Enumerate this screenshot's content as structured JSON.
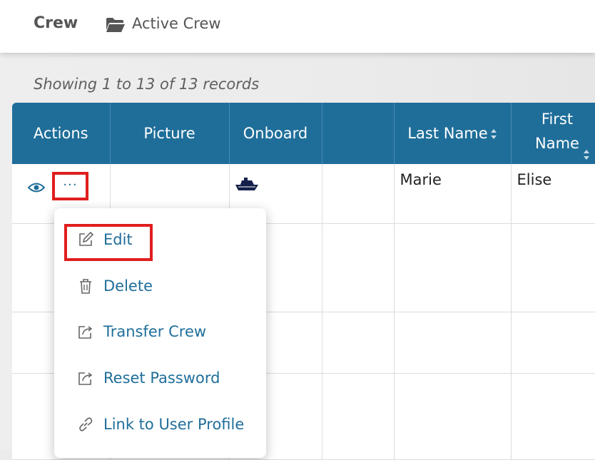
{
  "breadcrumb": {
    "root": "Crew",
    "active": "Active Crew",
    "active_icon": "folder-open-icon"
  },
  "records_info": "Showing 1 to 13 of 13 records",
  "table": {
    "columns": [
      {
        "label": "Actions",
        "sortable": false
      },
      {
        "label": "Picture",
        "sortable": false
      },
      {
        "label": "Onboard",
        "sortable": false
      },
      {
        "label": "",
        "sortable": false
      },
      {
        "label": "Last Name",
        "sortable": true
      },
      {
        "label": "First Name",
        "sortable": true
      }
    ],
    "rows": [
      {
        "last_name": "Marie",
        "first_name": "Elise",
        "onboard_icon": "ship-icon"
      }
    ]
  },
  "row_actions": {
    "view_icon": "eye-icon",
    "more_label": "···"
  },
  "context_menu": {
    "items": [
      {
        "label": "Edit",
        "icon": "edit-icon"
      },
      {
        "label": "Delete",
        "icon": "trash-icon"
      },
      {
        "label": "Transfer Crew",
        "icon": "export-icon"
      },
      {
        "label": "Reset Password",
        "icon": "export-icon"
      },
      {
        "label": "Link to User Profile",
        "icon": "link-icon"
      }
    ]
  },
  "colors": {
    "header_bg": "#1f6e9a",
    "accent": "#1f6e9a",
    "highlight": "#e01e1e"
  }
}
